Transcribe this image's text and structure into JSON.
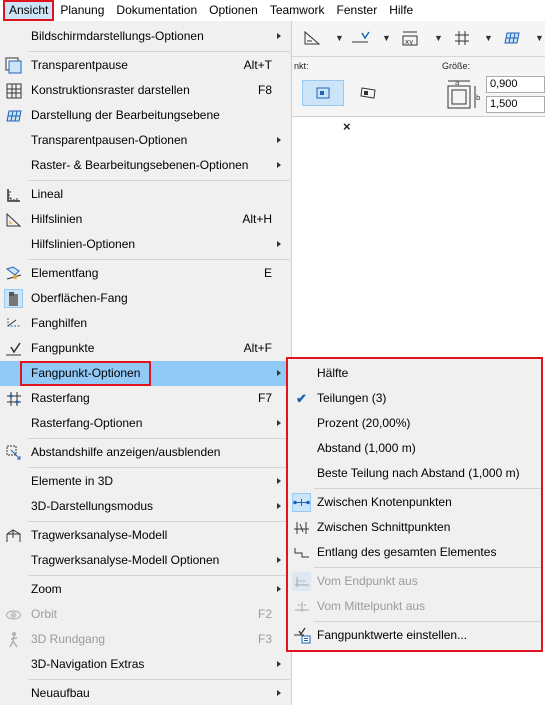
{
  "menubar": [
    "Ansicht",
    "Planung",
    "Dokumentation",
    "Optionen",
    "Teamwork",
    "Fenster",
    "Hilfe"
  ],
  "infobox": {
    "label_left": "nkt:",
    "label_right": "Größe:",
    "size_a": "0,900",
    "size_b": "1,500",
    "tab_close": "×"
  },
  "menu": {
    "items": [
      {
        "label": "Bildschirmdarstellungs-Optionen",
        "shortcut": "",
        "submenu": true,
        "icon": "",
        "disabled": false
      },
      {
        "label": "Transparentpause",
        "shortcut": "Alt+T",
        "submenu": false,
        "icon": "trace-icon",
        "disabled": false
      },
      {
        "label": "Konstruktionsraster darstellen",
        "shortcut": "F8",
        "submenu": false,
        "icon": "grid-icon",
        "disabled": false
      },
      {
        "label": "Darstellung der Bearbeitungsebene",
        "shortcut": "",
        "submenu": false,
        "icon": "editing-plane-icon",
        "disabled": false
      },
      {
        "label": "Transparentpausen-Optionen",
        "shortcut": "",
        "submenu": true,
        "icon": "",
        "disabled": false
      },
      {
        "label": "Raster- & Bearbeitungsebenen-Optionen",
        "shortcut": "",
        "submenu": true,
        "icon": "",
        "disabled": false
      },
      {
        "label": "Lineal",
        "shortcut": "",
        "submenu": false,
        "icon": "ruler-icon",
        "disabled": false
      },
      {
        "label": "Hilfslinien",
        "shortcut": "Alt+H",
        "submenu": false,
        "icon": "guide-lines-icon",
        "disabled": false
      },
      {
        "label": "Hilfslinien-Optionen",
        "shortcut": "",
        "submenu": true,
        "icon": "",
        "disabled": false
      },
      {
        "label": "Elementfang",
        "shortcut": "E",
        "submenu": false,
        "icon": "element-snap-icon",
        "disabled": false
      },
      {
        "label": "Oberflächen-Fang",
        "shortcut": "",
        "submenu": false,
        "icon": "surface-snap-icon",
        "disabled": false
      },
      {
        "label": "Fanghilfen",
        "shortcut": "",
        "submenu": false,
        "icon": "snap-guides-icon",
        "disabled": false
      },
      {
        "label": "Fangpunkte",
        "shortcut": "Alt+F",
        "submenu": false,
        "icon": "snap-points-icon",
        "disabled": false
      },
      {
        "label": "Fangpunkt-Optionen",
        "shortcut": "",
        "submenu": true,
        "icon": "",
        "disabled": false
      },
      {
        "label": "Rasterfang",
        "shortcut": "F7",
        "submenu": false,
        "icon": "grid-snap-icon",
        "disabled": false
      },
      {
        "label": "Rasterfang-Optionen",
        "shortcut": "",
        "submenu": true,
        "icon": "",
        "disabled": false
      },
      {
        "label": "Abstandshilfe anzeigen/ausblenden",
        "shortcut": "",
        "submenu": false,
        "icon": "distance-guide-icon",
        "disabled": false
      },
      {
        "label": "Elemente in 3D",
        "shortcut": "",
        "submenu": true,
        "icon": "",
        "disabled": false
      },
      {
        "label": "3D-Darstellungsmodus",
        "shortcut": "",
        "submenu": true,
        "icon": "",
        "disabled": false
      },
      {
        "label": "Tragwerksanalyse-Modell",
        "shortcut": "",
        "submenu": false,
        "icon": "structural-model-icon",
        "disabled": false
      },
      {
        "label": "Tragwerksanalyse-Modell Optionen",
        "shortcut": "",
        "submenu": true,
        "icon": "",
        "disabled": false
      },
      {
        "label": "Zoom",
        "shortcut": "",
        "submenu": true,
        "icon": "",
        "disabled": false
      },
      {
        "label": "Orbit",
        "shortcut": "F2",
        "submenu": false,
        "icon": "orbit-icon",
        "disabled": true
      },
      {
        "label": "3D Rundgang",
        "shortcut": "F3",
        "submenu": false,
        "icon": "walk-icon",
        "disabled": true
      },
      {
        "label": "3D-Navigation Extras",
        "shortcut": "",
        "submenu": true,
        "icon": "",
        "disabled": false
      },
      {
        "label": "Neuaufbau",
        "shortcut": "",
        "submenu": true,
        "icon": "",
        "disabled": false
      }
    ]
  },
  "submenu": {
    "items": [
      {
        "label": "Hälfte",
        "checked": false,
        "disabled": false,
        "icon": ""
      },
      {
        "label": "Teilungen (3)",
        "checked": true,
        "disabled": false,
        "icon": "check-icon"
      },
      {
        "label": "Prozent (20,00%)",
        "checked": false,
        "disabled": false,
        "icon": ""
      },
      {
        "label": "Abstand (1,000 m)",
        "checked": false,
        "disabled": false,
        "icon": ""
      },
      {
        "label": "Beste Teilung nach Abstand (1,000 m)",
        "checked": false,
        "disabled": false,
        "icon": ""
      },
      {
        "label": "Zwischen Knotenpunkten",
        "checked": true,
        "disabled": false,
        "icon": "between-nodes-icon"
      },
      {
        "label": "Zwischen Schnittpunkten",
        "checked": false,
        "disabled": false,
        "icon": "between-intersections-icon"
      },
      {
        "label": "Entlang des gesamten Elementes",
        "checked": false,
        "disabled": false,
        "icon": "along-element-icon"
      },
      {
        "label": "Vom Endpunkt aus",
        "checked": false,
        "disabled": true,
        "icon": "from-endpoint-icon"
      },
      {
        "label": "Vom Mittelpunkt aus",
        "checked": false,
        "disabled": true,
        "icon": "from-midpoint-icon"
      },
      {
        "label": "Fangpunktwerte einstellen...",
        "checked": false,
        "disabled": false,
        "icon": "set-snap-values-icon"
      }
    ]
  },
  "colors": {
    "highlight": "#91c9f7",
    "callout": "#e0141e",
    "accent": "#1e63b5"
  }
}
